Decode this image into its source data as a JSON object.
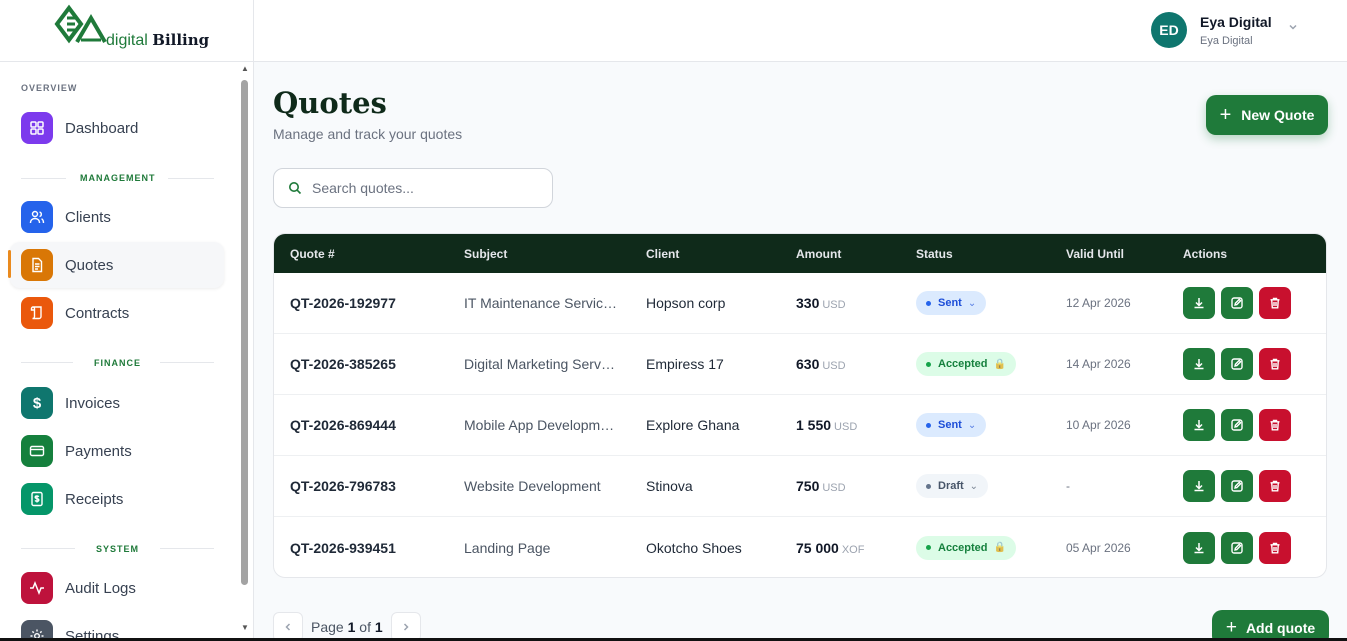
{
  "brand": {
    "word": "digital",
    "bold": "Billing"
  },
  "user": {
    "initials": "ED",
    "name": "Eya Digital",
    "org": "Eya Digital"
  },
  "sidebar": {
    "sections": {
      "overview": "OVERVIEW",
      "management": "MANAGEMENT",
      "finance": "FINANCE",
      "system": "SYSTEM"
    },
    "items": [
      {
        "label": "Dashboard",
        "icon": "dashboard-icon",
        "color": "#7c3aed"
      },
      {
        "label": "Clients",
        "icon": "users-icon",
        "color": "#2563eb"
      },
      {
        "label": "Quotes",
        "icon": "document-icon",
        "color": "#d97706"
      },
      {
        "label": "Contracts",
        "icon": "scroll-icon",
        "color": "#ea580c"
      },
      {
        "label": "Invoices",
        "icon": "dollar-icon",
        "color": "#0f766e"
      },
      {
        "label": "Payments",
        "icon": "credit-card-icon",
        "color": "#15803d"
      },
      {
        "label": "Receipts",
        "icon": "receipt-icon",
        "color": "#059669"
      },
      {
        "label": "Audit Logs",
        "icon": "activity-icon",
        "color": "#be123c"
      },
      {
        "label": "Settings",
        "icon": "gear-icon",
        "color": "#4b5563"
      }
    ]
  },
  "page": {
    "title": "Quotes",
    "subtitle": "Manage and track your quotes",
    "new_button": "New Quote",
    "search_placeholder": "Search quotes..."
  },
  "table": {
    "headers": [
      "Quote #",
      "Subject",
      "Client",
      "Amount",
      "Status",
      "Valid Until",
      "Actions"
    ],
    "rows": [
      {
        "number": "QT-2026-192977",
        "subject": "IT Maintenance Servic…",
        "client": "Hopson corp",
        "amount": "330",
        "currency": "USD",
        "status": "Sent",
        "status_type": "sent",
        "tail": "⌄",
        "valid": "12 Apr 2026"
      },
      {
        "number": "QT-2026-385265",
        "subject": "Digital Marketing Serv…",
        "client": "Empiress 17",
        "amount": "630",
        "currency": "USD",
        "status": "Accepted",
        "status_type": "accepted",
        "tail": "🔒",
        "valid": "14 Apr 2026"
      },
      {
        "number": "QT-2026-869444",
        "subject": "Mobile App Developm…",
        "client": "Explore Ghana",
        "amount": "1 550",
        "currency": "USD",
        "status": "Sent",
        "status_type": "sent",
        "tail": "⌄",
        "valid": "10 Apr 2026"
      },
      {
        "number": "QT-2026-796783",
        "subject": "Website Development",
        "client": "Stinova",
        "amount": "750",
        "currency": "USD",
        "status": "Draft",
        "status_type": "draft",
        "tail": "⌄",
        "valid": "-"
      },
      {
        "number": "QT-2026-939451",
        "subject": "Landing Page",
        "client": "Okotcho Shoes",
        "amount": "75 000",
        "currency": "XOF",
        "status": "Accepted",
        "status_type": "accepted",
        "tail": "🔒",
        "valid": "05 Apr 2026"
      }
    ]
  },
  "pager": {
    "page_word": "Page",
    "current": "1",
    "of_word": "of",
    "total": "1"
  },
  "add_button": "Add quote"
}
